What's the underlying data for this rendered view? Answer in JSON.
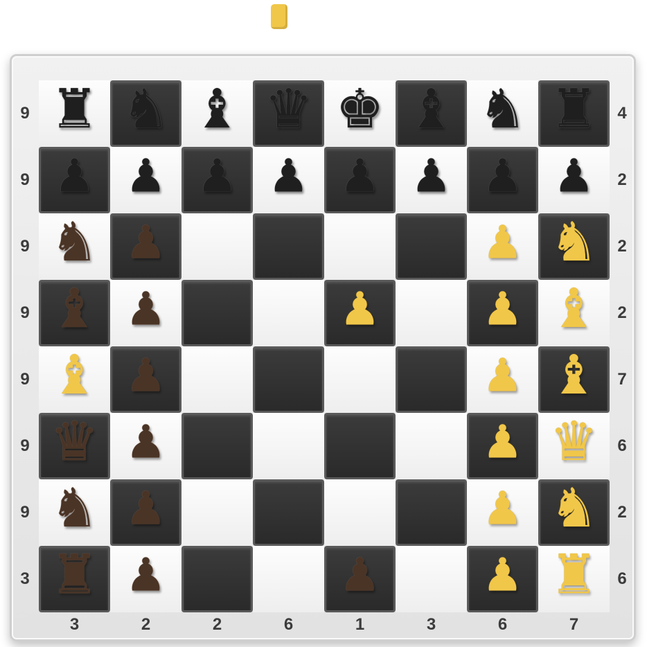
{
  "board": {
    "squares_color": {
      "light": "#f4f4f4",
      "dark": "#2f2f2f"
    },
    "left_labels": [
      "9",
      "9",
      "9",
      "9",
      "9",
      "9",
      "9",
      "3"
    ],
    "right_labels": [
      "4",
      "2",
      "2",
      "2",
      "7",
      "6",
      "2",
      "6"
    ],
    "bottom_labels": [
      "3",
      "2",
      "2",
      "6",
      "1",
      "3",
      "6",
      "7"
    ],
    "rows": [
      [
        {
          "p": "rook",
          "c": "black"
        },
        {
          "p": "knight",
          "c": "black"
        },
        {
          "p": "bishop",
          "c": "black"
        },
        {
          "p": "queen",
          "c": "black"
        },
        {
          "p": "king",
          "c": "black"
        },
        {
          "p": "bishop",
          "c": "black"
        },
        {
          "p": "knight",
          "c": "black"
        },
        {
          "p": "rook",
          "c": "black"
        }
      ],
      [
        {
          "p": "pawn",
          "c": "black"
        },
        {
          "p": "pawn",
          "c": "black"
        },
        {
          "p": "pawn",
          "c": "black"
        },
        {
          "p": "pawn",
          "c": "black"
        },
        {
          "p": "pawn",
          "c": "black"
        },
        {
          "p": "pawn",
          "c": "black"
        },
        {
          "p": "pawn",
          "c": "black"
        },
        {
          "p": "pawn",
          "c": "black"
        }
      ],
      [
        {
          "p": "knight",
          "c": "brown"
        },
        {
          "p": "pawn",
          "c": "brown"
        },
        null,
        null,
        null,
        null,
        {
          "p": "pawn",
          "c": "yellow"
        },
        {
          "p": "knight",
          "c": "yellow"
        }
      ],
      [
        {
          "p": "bishop",
          "c": "brown"
        },
        {
          "p": "pawn",
          "c": "brown"
        },
        null,
        null,
        {
          "p": "pawn",
          "c": "yellow"
        },
        null,
        {
          "p": "pawn",
          "c": "yellow"
        },
        {
          "p": "bishop",
          "c": "yellow"
        }
      ],
      [
        {
          "p": "bishop",
          "c": "yellow"
        },
        {
          "p": "pawn",
          "c": "brown"
        },
        null,
        null,
        null,
        null,
        {
          "p": "pawn",
          "c": "yellow"
        },
        {
          "p": "bishop",
          "c": "yellow"
        }
      ],
      [
        {
          "p": "queen",
          "c": "brown"
        },
        {
          "p": "pawn",
          "c": "brown"
        },
        null,
        null,
        null,
        null,
        {
          "p": "pawn",
          "c": "yellow"
        },
        {
          "p": "queen",
          "c": "yellow"
        }
      ],
      [
        {
          "p": "knight",
          "c": "brown"
        },
        {
          "p": "pawn",
          "c": "brown"
        },
        null,
        null,
        null,
        null,
        {
          "p": "pawn",
          "c": "yellow"
        },
        {
          "p": "knight",
          "c": "yellow"
        }
      ],
      [
        {
          "p": "rook",
          "c": "brown"
        },
        {
          "p": "pawn",
          "c": "brown"
        },
        null,
        null,
        {
          "p": "pawn",
          "c": "brown"
        },
        null,
        {
          "p": "pawn",
          "c": "yellow"
        },
        {
          "p": "rook",
          "c": "yellow"
        }
      ]
    ]
  },
  "piece_colors": {
    "black": "#1f1f1f",
    "brown": "#4a3426",
    "yellow": "#f1c74a"
  }
}
